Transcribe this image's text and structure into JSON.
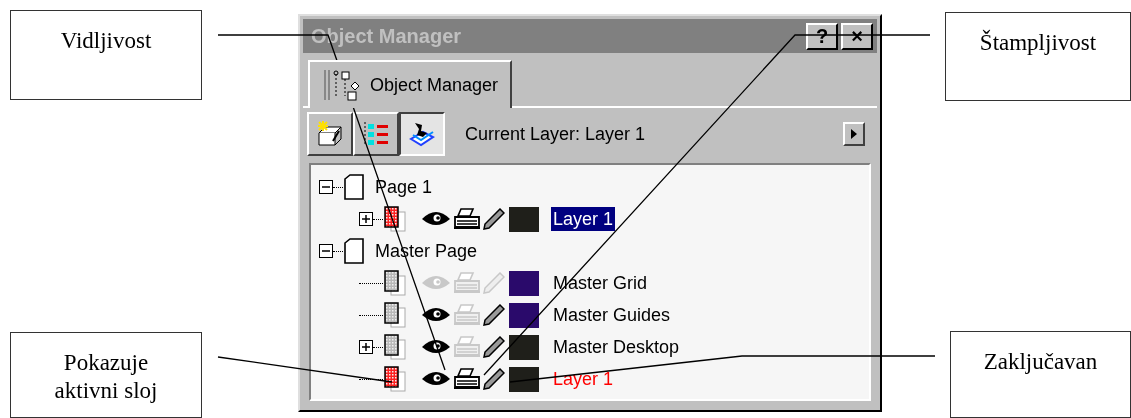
{
  "callouts": [
    {
      "text": "Vidljivost"
    },
    {
      "text": "Štampljivost"
    },
    {
      "text": "Pokazuje aktivni sloj"
    },
    {
      "text": "Zaključavan"
    }
  ],
  "window": {
    "title": "Object Manager",
    "buttons": [
      "?",
      "×"
    ]
  },
  "tabs": [
    {
      "label": "Object Manager",
      "selected": true
    }
  ],
  "toolbar": {
    "buttons": [
      {
        "kind": "new-layer",
        "selected": false
      },
      {
        "kind": "layer-list",
        "selected": false
      },
      {
        "kind": "layer-view",
        "selected": true
      }
    ],
    "current_layer": "Current Layer: Layer 1"
  },
  "tree": [
    {
      "kind": "page",
      "label": "Page 1",
      "expanded": true,
      "children": [
        {
          "kind": "layer",
          "label": "Layer 1",
          "expanded": false,
          "visible": true,
          "printable": true,
          "editable": true,
          "color": "#1f1f1a",
          "selected": true,
          "active": false
        }
      ]
    },
    {
      "kind": "page",
      "label": "Master Page",
      "expanded": true,
      "children": [
        {
          "kind": "master_layer",
          "label": "Master Grid",
          "visible": false,
          "printable": false,
          "editable": false,
          "color": "#2a0a6b",
          "selected": false,
          "active": false
        },
        {
          "kind": "master_layer",
          "label": "Master Guides",
          "visible": true,
          "printable": false,
          "editable": true,
          "color": "#2a0a6b",
          "selected": false,
          "active": false
        },
        {
          "kind": "master_layer",
          "label": "Master Desktop",
          "expanded": false,
          "visible": true,
          "printable": false,
          "editable": true,
          "color": "#1f1f1a",
          "selected": false,
          "active": false
        },
        {
          "kind": "layer",
          "label": "Layer 1",
          "visible": true,
          "printable": true,
          "editable": true,
          "color": "#1f1f1a",
          "selected": false,
          "active": true
        }
      ]
    }
  ]
}
